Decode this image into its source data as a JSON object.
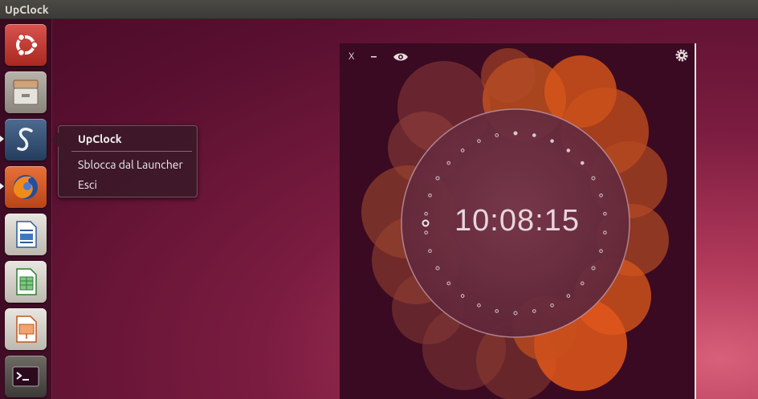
{
  "window": {
    "title": "UpClock"
  },
  "launcher": {
    "items": [
      {
        "name": "dash-home",
        "icon": "ubuntu-logo-icon"
      },
      {
        "name": "files",
        "icon": "file-cabinet-icon"
      },
      {
        "name": "upclock",
        "icon": "upclock-s-icon"
      },
      {
        "name": "firefox",
        "icon": "firefox-icon"
      },
      {
        "name": "writer",
        "icon": "libreoffice-writer-icon"
      },
      {
        "name": "calc",
        "icon": "libreoffice-calc-icon"
      },
      {
        "name": "impress",
        "icon": "libreoffice-impress-icon"
      },
      {
        "name": "terminal",
        "icon": "terminal-icon"
      }
    ]
  },
  "tooltip": {
    "title": "UpClock",
    "items": [
      "Sblocca dal Launcher",
      "Esci"
    ]
  },
  "clock": {
    "close_label": "X",
    "minimize_label": "–",
    "time": "10:08:15",
    "accent": "#e2571b"
  }
}
